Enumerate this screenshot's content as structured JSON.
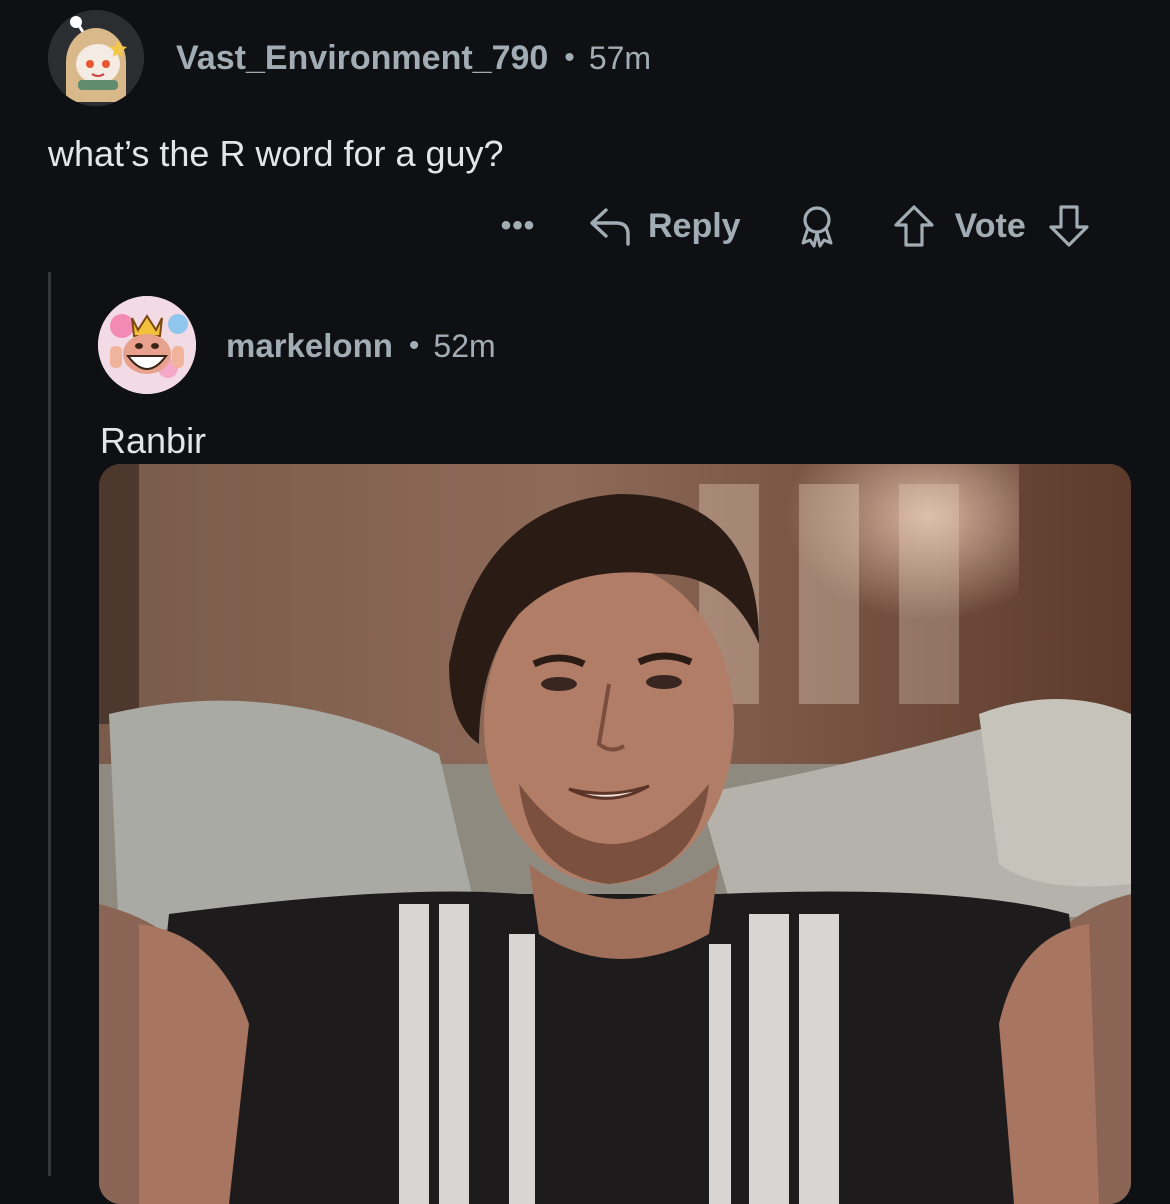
{
  "top_comment": {
    "avatar_icon": "snoo-avatar-girl-icon",
    "username": "Vast_Environment_790",
    "separator": "•",
    "time": "57m",
    "body": "what’s the R word for a guy?",
    "actions": {
      "more": "•••",
      "reply": "Reply",
      "award_icon": "award-icon",
      "vote": "Vote"
    }
  },
  "reply_comment": {
    "avatar_icon": "clash-king-avatar-icon",
    "username": "markelonn",
    "separator": "•",
    "time": "52m",
    "body": "Ranbir",
    "media": {
      "type": "gif",
      "description_icon": "gif-image"
    }
  },
  "colors": {
    "background": "#0e1013",
    "meta_text": "#a2acb4",
    "body_text": "#e2e6e9",
    "thread_line": "#34383d"
  }
}
